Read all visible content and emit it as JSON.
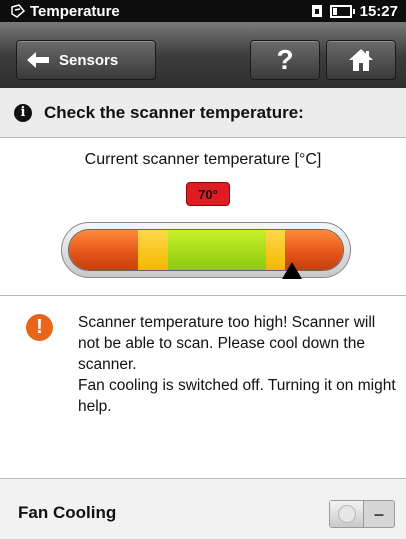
{
  "statusbar": {
    "title": "Temperature",
    "time": "15:27"
  },
  "toolbar": {
    "back_label": "Sensors",
    "help_label": "?",
    "home_icon": "home-icon"
  },
  "header": {
    "text": "Check the scanner temperature:",
    "icon": "info-icon"
  },
  "temperature": {
    "label": "Current scanner temperature [°C]",
    "value_label": "70°",
    "badge_color": "#e11b22",
    "gauge": {
      "segments": [
        {
          "zone": "red",
          "fraction": 0.25
        },
        {
          "zone": "yellow",
          "fraction": 0.11
        },
        {
          "zone": "green",
          "fraction": 0.36
        },
        {
          "zone": "yellow",
          "fraction": 0.07
        },
        {
          "zone": "red",
          "fraction": 0.21
        }
      ],
      "marker_fraction": 0.81
    }
  },
  "warning": {
    "icon": "warning-icon",
    "color": "#e8651a",
    "line1": "Scanner temperature too high! Scanner will not be able to scan. Please cool down the scanner.",
    "line2": "Fan cooling is switched off. Turning it on might help."
  },
  "fan_cooling": {
    "label": "Fan Cooling",
    "state_label": "–",
    "on": false
  }
}
